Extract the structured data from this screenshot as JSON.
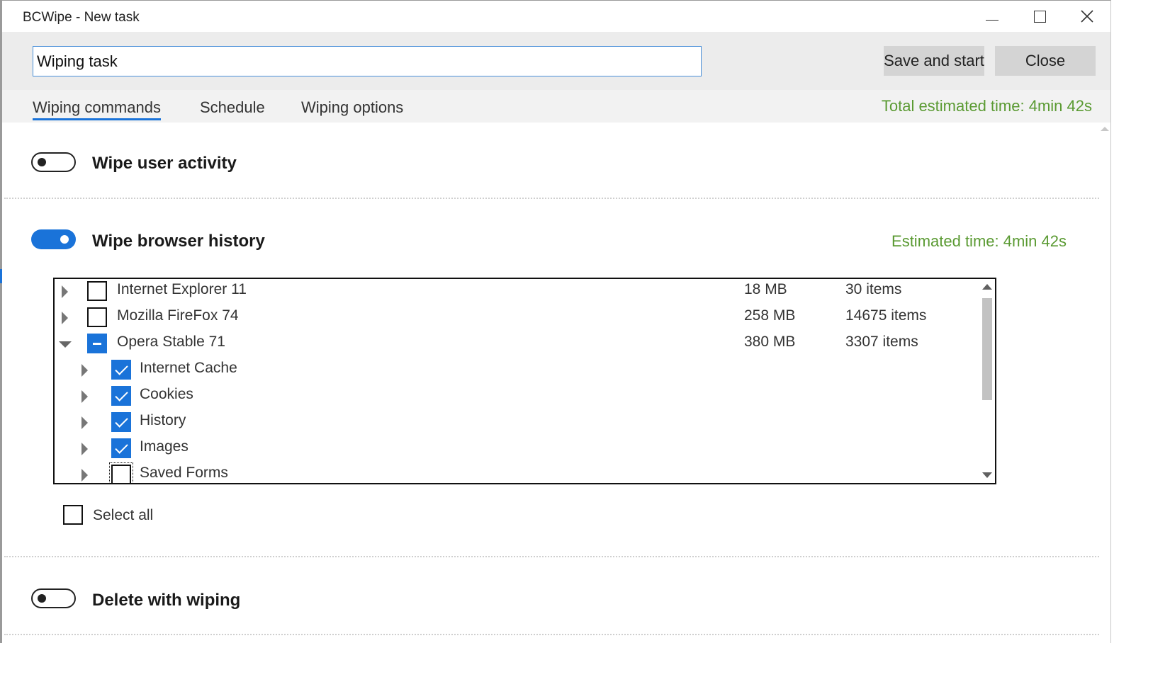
{
  "window": {
    "title": "BCWipe - New task"
  },
  "toolbar": {
    "task_name_value": "Wiping task",
    "save_label": "Save and start",
    "close_label": "Close"
  },
  "tabs": [
    {
      "label": "Wiping commands",
      "active": true
    },
    {
      "label": "Schedule",
      "active": false
    },
    {
      "label": "Wiping options",
      "active": false
    }
  ],
  "total_estimated_time": "Total estimated time: 4min 42s",
  "sections": {
    "user_activity": {
      "label": "Wipe user activity",
      "enabled": false
    },
    "browser_history": {
      "label": "Wipe browser history",
      "enabled": true,
      "estimated_time": "Estimated time: 4min 42s"
    },
    "delete_with_wiping": {
      "label": "Delete with wiping",
      "enabled": false
    }
  },
  "browser_tree": [
    {
      "label": "Internet Explorer 11",
      "size": "18 MB",
      "items": "30 items",
      "state": "unchecked",
      "expanded": false
    },
    {
      "label": "Mozilla FireFox 74",
      "size": "258 MB",
      "items": "14675 items",
      "state": "unchecked",
      "expanded": false
    },
    {
      "label": "Opera Stable 71",
      "size": "380 MB",
      "items": "3307 items",
      "state": "partial",
      "expanded": true
    },
    {
      "label": "Internet Cache",
      "state": "checked"
    },
    {
      "label": "Cookies",
      "state": "checked"
    },
    {
      "label": "History",
      "state": "checked"
    },
    {
      "label": "Images",
      "state": "checked"
    },
    {
      "label": "Saved Forms",
      "state": "unchecked"
    }
  ],
  "select_all_label": "Select all",
  "colors": {
    "accent": "#1a73d9",
    "time_green": "#5a9a32"
  }
}
